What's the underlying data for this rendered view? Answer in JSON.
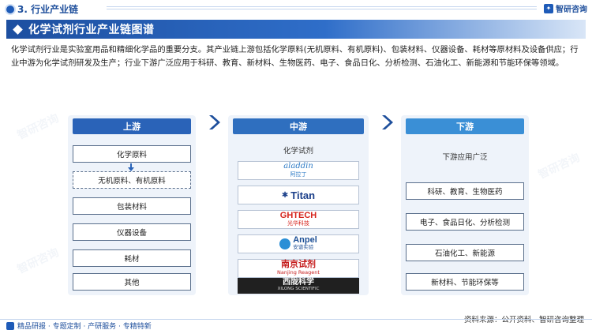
{
  "header": {
    "section_title": "3. 行业产业链",
    "brand": "智研咨询"
  },
  "banner": {
    "title": "化学试剂行业产业链图谱"
  },
  "intro": "化学试剂行业是实验室用品和精细化学品的重要分支。其产业链上游包括化学原料(无机原料、有机原料)、包装材料、仪器设备、耗材等原材料及设备供应；行业中游为化学试剂研发及生产；行业下游广泛应用于科研、教育、新材料、生物医药、电子、食品日化、分析检测、石油化工、新能源和节能环保等领域。",
  "upstream": {
    "title": "上游",
    "items": [
      "化学原料",
      "无机原料、有机原料",
      "包装材料",
      "仪器设备",
      "耗材",
      "其他"
    ]
  },
  "midstream": {
    "title": "中游",
    "label": "化学试剂",
    "logos": [
      {
        "name": "aladdin",
        "sub": "阿拉丁"
      },
      {
        "name": "Titan"
      },
      {
        "name": "GHTECH",
        "sub": "光华科技"
      },
      {
        "name": "Anpel",
        "sub": "安谱实验"
      },
      {
        "name": "南京试剂",
        "sub": "Nanjing Reagent"
      },
      {
        "name": "西陇科学",
        "sub": "XILONG SCIENTIFIC"
      }
    ]
  },
  "downstream": {
    "title": "下游",
    "label": "下游应用广泛",
    "items": [
      "科研、教育、生物医药",
      "电子、食品日化、分析检测",
      "石油化工、新能源",
      "新材料、节能环保等"
    ]
  },
  "footer": {
    "source": "资料来源：公开资料、智研咨询整理",
    "services": "精品研报 · 专题定制 · 产研服务 · 专精特新"
  },
  "colors": {
    "primary": "#1e4f9c",
    "upstream": "#2a63b8",
    "midstream": "#2f6fbf",
    "downstream": "#3a8fd6",
    "panel": "#eef3fa"
  }
}
